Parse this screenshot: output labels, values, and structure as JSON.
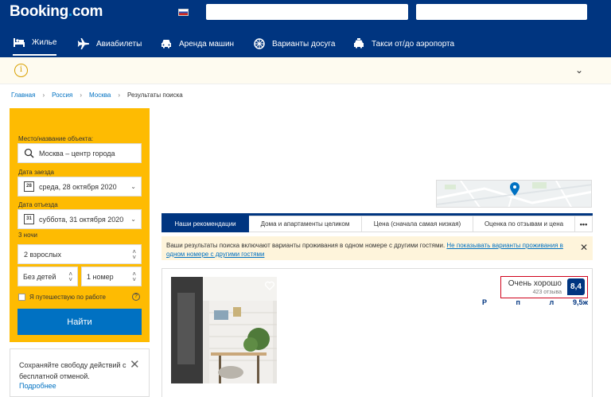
{
  "header": {
    "logo_main": "Booking",
    "logo_dot": ".",
    "logo_tld": "com"
  },
  "nav": {
    "items": [
      {
        "label": "Жилье",
        "icon": "bed-icon"
      },
      {
        "label": "Авиабилеты",
        "icon": "plane-icon"
      },
      {
        "label": "Аренда машин",
        "icon": "car-icon"
      },
      {
        "label": "Варианты досуга",
        "icon": "attractions-icon"
      },
      {
        "label": "Такси от/до аэропорта",
        "icon": "taxi-icon"
      }
    ]
  },
  "info_bar": {
    "icon_glyph": "i",
    "chevron_glyph": "⌄"
  },
  "breadcrumbs": {
    "items": [
      "Главная",
      "Россия",
      "Москва",
      "Результаты поиска"
    ],
    "separator": "›"
  },
  "search": {
    "destination_label": "Место/название объекта:",
    "destination_value": "Москва – центр города",
    "checkin_label": "Дата заезда",
    "checkin_day": "28",
    "checkin_value": "среда, 28 октября 2020",
    "checkout_label": "Дата отъезда",
    "checkout_day": "31",
    "checkout_value": "суббота, 31 октября 2020",
    "nights": "3 ночи",
    "adults": "2 взрослых",
    "children": "Без детей",
    "rooms": "1 номер",
    "work_trip_label": "Я путешествую по работе",
    "help_glyph": "?",
    "search_button": "Найти"
  },
  "promo": {
    "text": "Сохраняйте свободу действий с бесплатной отменой.",
    "link": "Подробнее",
    "close_glyph": "✕"
  },
  "tabs": {
    "items": [
      "Наши рекомендации",
      "Дома и апартаменты целиком",
      "Цена (сначала самая низкая)",
      "Оценка по отзывам и цена",
      "•••"
    ],
    "active_index": 0
  },
  "notice": {
    "text": "Ваши результаты поиска включают варианты проживания в одном номере с другими гостями.",
    "link": "Не показывать варианты проживания в одном номере с другими гостями",
    "close_glyph": "✕"
  },
  "listing": {
    "score_word": "Очень хорошо",
    "reviews": "423 отзыва",
    "score": "8,4",
    "beach_letters": "Р п л ж и",
    "beach_score": "9,5"
  },
  "colors": {
    "brand_dark": "#003580",
    "brand_blue": "#0071c2",
    "search_bg": "#febb02",
    "notice_bg": "#fef4db",
    "highlight_red": "#d0021b"
  }
}
